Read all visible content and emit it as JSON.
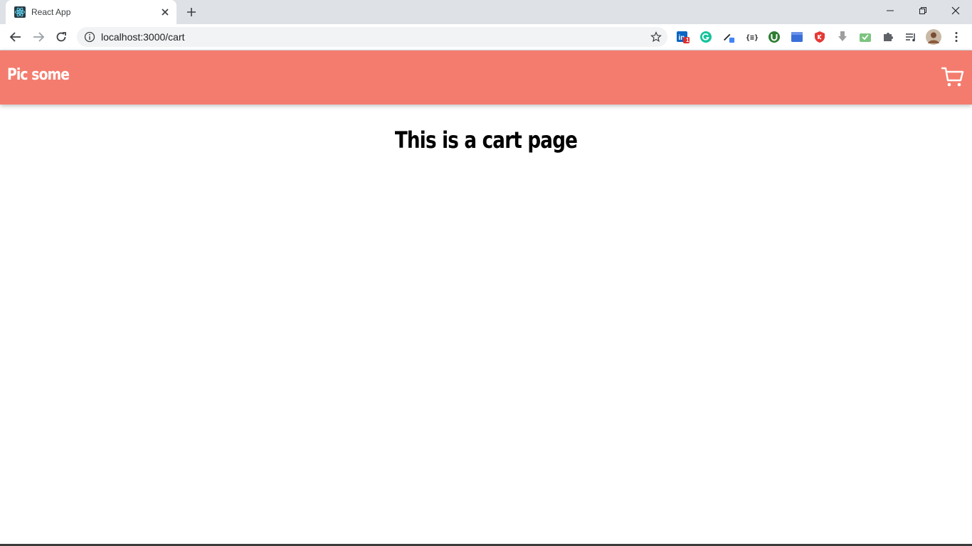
{
  "browser": {
    "tab": {
      "title": "React App",
      "favicon": "react-logo-icon"
    },
    "address": {
      "url": "localhost:3000/cart"
    },
    "extensions": [
      {
        "name": "linkedin-icon",
        "badge": "1"
      },
      {
        "name": "grammarly-icon"
      },
      {
        "name": "color-picker-icon"
      },
      {
        "name": "json-formatter-icon"
      },
      {
        "name": "utorrent-icon"
      },
      {
        "name": "window-icon"
      },
      {
        "name": "shield-red-icon"
      },
      {
        "name": "download-icon"
      },
      {
        "name": "inbox-check-icon"
      },
      {
        "name": "puzzle-icon"
      },
      {
        "name": "media-list-icon"
      },
      {
        "name": "profile-avatar-icon"
      },
      {
        "name": "kebab-menu-icon"
      }
    ]
  },
  "app": {
    "brand": "Pic some",
    "header_color": "#f47c6e",
    "cart_icon": "cart-icon"
  },
  "main": {
    "heading": "This is a cart page"
  }
}
